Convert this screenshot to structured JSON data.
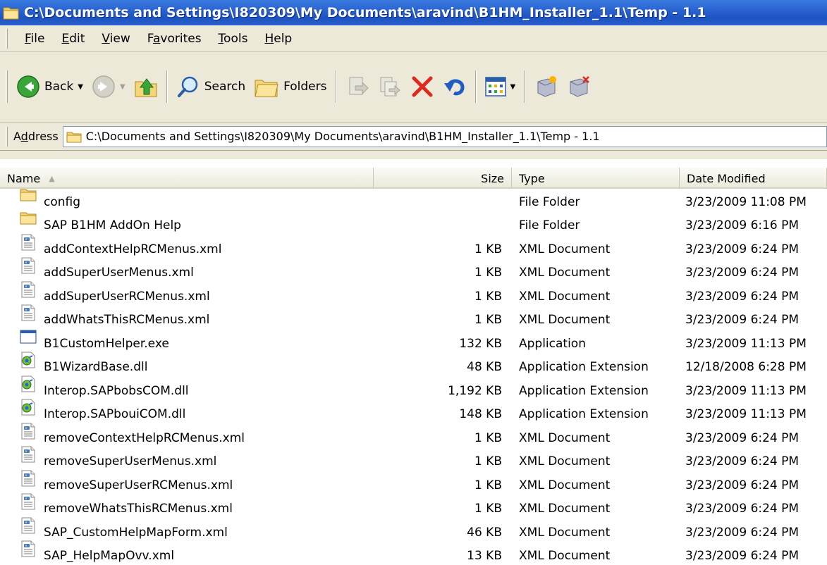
{
  "window": {
    "title": "C:\\Documents and Settings\\I820309\\My Documents\\aravind\\B1HM_Installer_1.1\\Temp - 1.1"
  },
  "menu": [
    {
      "label": "File",
      "key": "F"
    },
    {
      "label": "Edit",
      "key": "E"
    },
    {
      "label": "View",
      "key": "V"
    },
    {
      "label": "Favorites",
      "key": "a"
    },
    {
      "label": "Tools",
      "key": "T"
    },
    {
      "label": "Help",
      "key": "H"
    }
  ],
  "toolbar": {
    "back_label": "Back",
    "search_label": "Search",
    "folders_label": "Folders"
  },
  "address": {
    "label": "Address",
    "value": "C:\\Documents and Settings\\I820309\\My Documents\\aravind\\B1HM_Installer_1.1\\Temp - 1.1"
  },
  "columns": {
    "name": "Name",
    "size": "Size",
    "type": "Type",
    "date": "Date Modified"
  },
  "files": [
    {
      "name": "config",
      "size": "",
      "type": "File Folder",
      "date": "3/23/2009 11:08 PM",
      "icon": "folder-icon"
    },
    {
      "name": "SAP B1HM AddOn Help",
      "size": "",
      "type": "File Folder",
      "date": "3/23/2009 6:16 PM",
      "icon": "folder-icon"
    },
    {
      "name": "addContextHelpRCMenus.xml",
      "size": "1 KB",
      "type": "XML Document",
      "date": "3/23/2009 6:24 PM",
      "icon": "xml-icon"
    },
    {
      "name": "addSuperUserMenus.xml",
      "size": "1 KB",
      "type": "XML Document",
      "date": "3/23/2009 6:24 PM",
      "icon": "xml-icon"
    },
    {
      "name": "addSuperUserRCMenus.xml",
      "size": "1 KB",
      "type": "XML Document",
      "date": "3/23/2009 6:24 PM",
      "icon": "xml-icon"
    },
    {
      "name": "addWhatsThisRCMenus.xml",
      "size": "1 KB",
      "type": "XML Document",
      "date": "3/23/2009 6:24 PM",
      "icon": "xml-icon"
    },
    {
      "name": "B1CustomHelper.exe",
      "size": "132 KB",
      "type": "Application",
      "date": "3/23/2009 11:13 PM",
      "icon": "exe-icon"
    },
    {
      "name": "B1WizardBase.dll",
      "size": "48 KB",
      "type": "Application Extension",
      "date": "12/18/2008 6:28 PM",
      "icon": "dll-icon"
    },
    {
      "name": "Interop.SAPbobsCOM.dll",
      "size": "1,192 KB",
      "type": "Application Extension",
      "date": "3/23/2009 11:13 PM",
      "icon": "dll-icon"
    },
    {
      "name": "Interop.SAPbouiCOM.dll",
      "size": "148 KB",
      "type": "Application Extension",
      "date": "3/23/2009 11:13 PM",
      "icon": "dll-icon"
    },
    {
      "name": "removeContextHelpRCMenus.xml",
      "size": "1 KB",
      "type": "XML Document",
      "date": "3/23/2009 6:24 PM",
      "icon": "xml-icon"
    },
    {
      "name": "removeSuperUserMenus.xml",
      "size": "1 KB",
      "type": "XML Document",
      "date": "3/23/2009 6:24 PM",
      "icon": "xml-icon"
    },
    {
      "name": "removeSuperUserRCMenus.xml",
      "size": "1 KB",
      "type": "XML Document",
      "date": "3/23/2009 6:24 PM",
      "icon": "xml-icon"
    },
    {
      "name": "removeWhatsThisRCMenus.xml",
      "size": "1 KB",
      "type": "XML Document",
      "date": "3/23/2009 6:24 PM",
      "icon": "xml-icon"
    },
    {
      "name": "SAP_CustomHelpMapForm.xml",
      "size": "46 KB",
      "type": "XML Document",
      "date": "3/23/2009 6:24 PM",
      "icon": "xml-icon"
    },
    {
      "name": "SAP_HelpMapOvv.xml",
      "size": "13 KB",
      "type": "XML Document",
      "date": "3/23/2009 6:24 PM",
      "icon": "xml-icon"
    }
  ],
  "colors": {
    "titlebar": "#2a64d0",
    "chrome": "#ece9d8",
    "folder": "#f3d67a"
  }
}
